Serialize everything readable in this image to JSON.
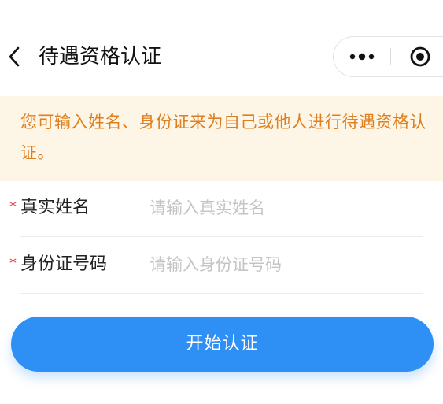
{
  "header": {
    "title": "待遇资格认证",
    "back_icon": "chevron-left-icon",
    "more_icon": "more-dots-icon",
    "close_icon": "target-close-icon"
  },
  "notice": {
    "text": "您可输入姓名、身份证来为自己或他人进行待遇资格认证。"
  },
  "form": {
    "name_field": {
      "required_mark": "*",
      "label": "真实姓名",
      "placeholder": "请输入真实姓名",
      "value": ""
    },
    "id_field": {
      "required_mark": "*",
      "label": "身份证号码",
      "placeholder": "请输入身份证号码",
      "value": ""
    }
  },
  "actions": {
    "start_label": "开始认证"
  },
  "colors": {
    "accent": "#2e8ff5",
    "notice_text": "#e07f1f",
    "notice_bg": "#fdf6e6",
    "required": "#e2382f"
  }
}
